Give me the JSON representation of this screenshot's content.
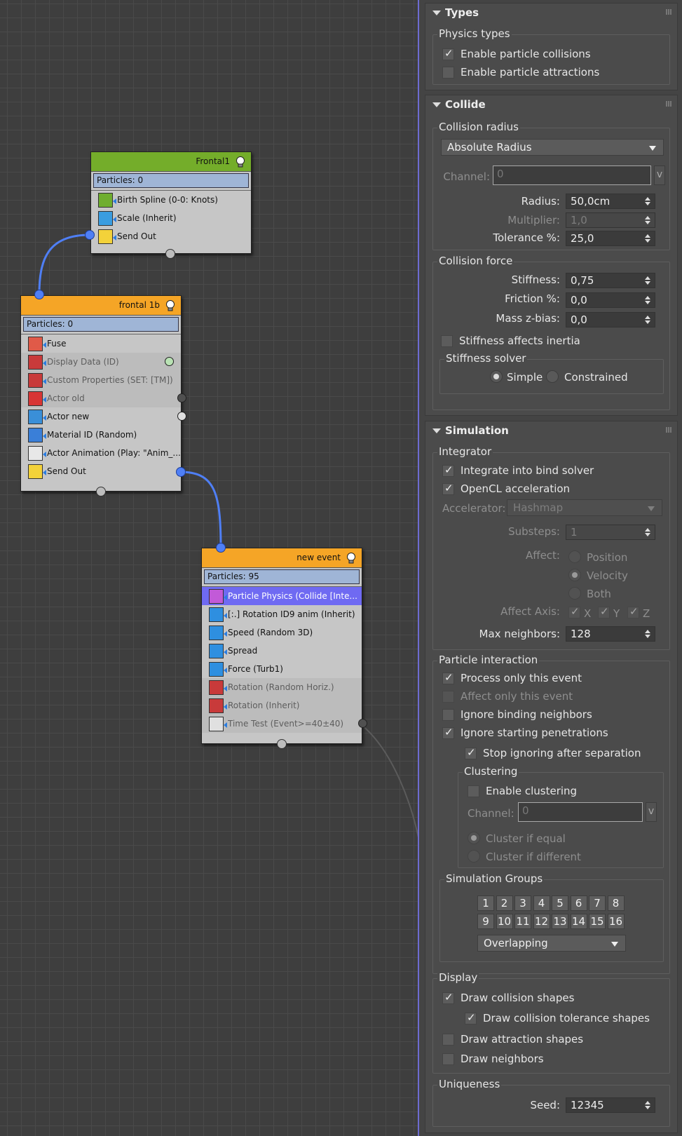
{
  "nodes": {
    "frontal1": {
      "title": "Frontal1",
      "particles": "Particles: 0",
      "ops": [
        "Birth Spline (0-0: Knots)",
        "Scale (Inherit)",
        "Send Out"
      ]
    },
    "frontal1b": {
      "title": "frontal 1b",
      "particles": "Particles: 0",
      "ops": [
        "Fuse",
        "Display Data (ID)",
        "Custom Properties (SET: [TM])",
        "Actor old",
        "Actor new",
        "Material ID (Random)",
        "Actor Animation (Play: \"Anim_...",
        "Send Out"
      ]
    },
    "new_event": {
      "title": "new event",
      "particles": "Particles: 95",
      "ops": [
        "Particle Physics (Collide [Inte...",
        "[:.] Rotation ID9 anim (Inherit)",
        "Speed (Random 3D)",
        "Spread",
        "Force (Turb1)",
        "Rotation (Random Horiz.)",
        "Rotation (Inherit)",
        "Time Test (Event>=40±40)"
      ]
    }
  },
  "panel": {
    "types": {
      "title": "Types",
      "group": "Physics types",
      "enable_collisions": "Enable particle collisions",
      "enable_attractions": "Enable particle attractions"
    },
    "collide": {
      "title": "Collide",
      "radius_group": "Collision radius",
      "radius_mode": "Absolute Radius",
      "channel_label": "Channel:",
      "channel_value": "0",
      "channel_btn": "v",
      "radius_label": "Radius:",
      "radius_value": "50,0cm",
      "multiplier_label": "Multiplier:",
      "multiplier_value": "1,0",
      "tolerance_label": "Tolerance %:",
      "tolerance_value": "25,0",
      "force_group": "Collision force",
      "stiffness_label": "Stiffness:",
      "stiffness_value": "0,75",
      "friction_label": "Friction %:",
      "friction_value": "0,0",
      "massbias_label": "Mass z-bias:",
      "massbias_value": "0,0",
      "stiffness_inertia": "Stiffness affects inertia",
      "solver_group": "Stiffness solver",
      "solver_simple": "Simple",
      "solver_constrained": "Constrained"
    },
    "simulation": {
      "title": "Simulation",
      "integrator_group": "Integrator",
      "bind_solver": "Integrate into bind solver",
      "opencl": "OpenCL acceleration",
      "accelerator_label": "Accelerator:",
      "accelerator_value": "Hashmap",
      "substeps_label": "Substeps:",
      "substeps_value": "1",
      "affect_label": "Affect:",
      "affect_position": "Position",
      "affect_velocity": "Velocity",
      "affect_both": "Both",
      "axis_label": "Affect Axis:",
      "axis_x": "X",
      "axis_y": "Y",
      "axis_z": "Z",
      "maxn_label": "Max neighbors:",
      "maxn_value": "128",
      "interaction_group": "Particle interaction",
      "process_only": "Process only this event",
      "affect_only": "Affect only this event",
      "ignore_binding": "Ignore binding neighbors",
      "ignore_penetrations": "Ignore starting penetrations",
      "stop_ignoring": "Stop ignoring after separation",
      "clustering_group": "Clustering",
      "enable_clustering": "Enable clustering",
      "cl_channel_label": "Channel:",
      "cl_channel_value": "0",
      "cl_channel_btn": "v",
      "cluster_equal": "Cluster if equal",
      "cluster_different": "Cluster if different",
      "groups_title": "Simulation Groups",
      "groups": [
        "1",
        "2",
        "3",
        "4",
        "5",
        "6",
        "7",
        "8",
        "9",
        "10",
        "11",
        "12",
        "13",
        "14",
        "15",
        "16"
      ],
      "groups_mode": "Overlapping",
      "display_group": "Display",
      "draw_collision": "Draw collision shapes",
      "draw_tolerance": "Draw collision tolerance shapes",
      "draw_attraction": "Draw attraction shapes",
      "draw_neighbors": "Draw neighbors",
      "uniqueness_group": "Uniqueness",
      "seed_label": "Seed:",
      "seed_value": "12345"
    }
  },
  "colors": {
    "frontal1_header": "#74ad2a",
    "frontal1b_header": "#f5a526",
    "new_event_header": "#f5a526",
    "selected_op": "#6f6af2",
    "port_blue": "#4f7ff5",
    "panel_accent": "#6d6bd1"
  }
}
